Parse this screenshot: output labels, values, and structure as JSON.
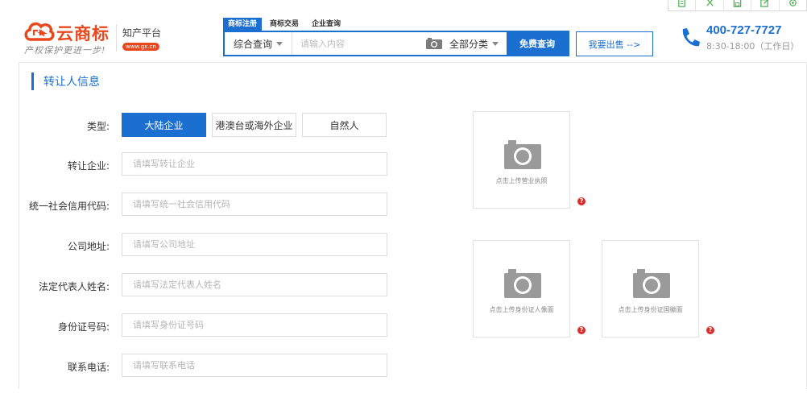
{
  "header": {
    "brand_name": "云商标",
    "brand_slogan": "产权保护更进一步!",
    "platform_name": "知产平台",
    "domain_badge": "www.gx.cn",
    "search_tabs": [
      "商标注册",
      "商标交易",
      "企业查询"
    ],
    "active_tab": 0,
    "search_scope": "综合查询",
    "search_placeholder": "请输入内容",
    "search_category": "全部分类",
    "search_button": "免费查询",
    "sell_button": "我要出售 -->",
    "hotline_number": "400-727-7727",
    "hotline_hours": "8:30-18:00（工作日）"
  },
  "toolbar": {
    "icons": [
      "copy-icon",
      "scissors-icon",
      "save-icon",
      "export-icon",
      "settings-icon"
    ]
  },
  "section": {
    "title": "转让人信息"
  },
  "form": {
    "type_label": "类型:",
    "type_options": [
      "大陆企业",
      "港澳台或海外企业",
      "自然人"
    ],
    "selected_type": "大陆企业",
    "fields": [
      {
        "label": "转让企业:",
        "placeholder": "请填写转让企业",
        "value": ""
      },
      {
        "label": "统一社会信用代码:",
        "placeholder": "请填写统一社会信用代码",
        "value": ""
      },
      {
        "label": "公司地址:",
        "placeholder": "请填写公司地址",
        "value": ""
      },
      {
        "label": "法定代表人姓名:",
        "placeholder": "请填写法定代表人姓名",
        "value": ""
      },
      {
        "label": "身份证号码:",
        "placeholder": "请填写身份证号码",
        "value": ""
      },
      {
        "label": "联系电话:",
        "placeholder": "请填写联系电话",
        "value": ""
      }
    ]
  },
  "uploads": {
    "business_license": "点击上传营业执照",
    "id_front": "点击上传身份证人像面",
    "id_back": "点击上传身份证国徽面",
    "help_mark": "?"
  },
  "colors": {
    "primary": "#1a6fd0",
    "brand": "#e8481c",
    "help": "#e02b2b"
  }
}
